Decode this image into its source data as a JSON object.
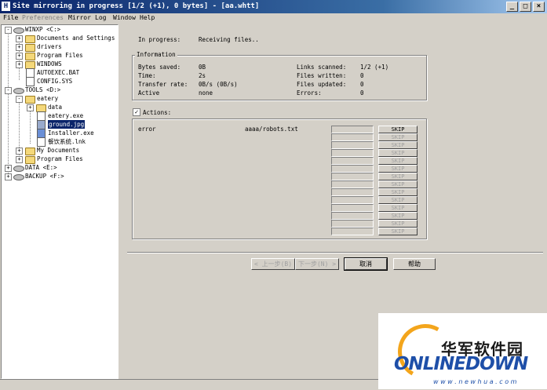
{
  "window": {
    "title": "Site mirroring in progress [1/2 (+1), 0 bytes] - [aa.whtt]",
    "app_icon": "H",
    "min": "_",
    "max": "□",
    "close": "×"
  },
  "menu": {
    "file": "File",
    "preferences": "Preferences",
    "mirror": "Mirror",
    "log": "Log",
    "window": "Window",
    "help": "Help"
  },
  "tree": {
    "winxp": "WINXP <C:>",
    "documents": "Documents and Settings",
    "drivers": "drivers",
    "program_files": "Program Files",
    "windows": "WINDOWS",
    "autoexec": "AUTOEXEC.BAT",
    "config": "CONFIG.SYS",
    "tools": "TOOLS <D:>",
    "eatery": "eatery",
    "data": "data",
    "eatery_exe": "eatery.exe",
    "ground": "ground.jpg",
    "installer": "Installer.exe",
    "lnk": "餐饮系统.lnk",
    "my_documents": "My Documents",
    "program_files2": "Program Files",
    "data_drive": "DATA <E:>",
    "backup_drive": "BACKUP <F:>"
  },
  "progress": {
    "label": "In progress:",
    "value": "Receiving files.."
  },
  "info": {
    "title": "Information",
    "bytes_saved_label": "Bytes saved:",
    "bytes_saved": "0B",
    "time_label": "Time:",
    "time": "2s",
    "rate_label": "Transfer rate:",
    "rate": "0B/s (0B/s)",
    "active_label": "Active",
    "active": "none",
    "links_label": "Links scanned:",
    "links": "1/2 (+1)",
    "written_label": "Files written:",
    "written": "0",
    "updated_label": "Files updated:",
    "updated": "0",
    "errors_label": "Errors:",
    "errors": "0"
  },
  "actions": {
    "title": "Actions:",
    "row1_status": "error",
    "row1_file": "aaaa/robots.txt",
    "skip": "SKIP"
  },
  "buttons": {
    "back": "< 上一步(B)",
    "next": "下一步(N) >",
    "cancel": "取消",
    "help": "帮助"
  },
  "watermark": {
    "cn": "华军软件园",
    "logo": "ONLINEDOWN",
    "url": "w w w . n e w h u a . c o m"
  }
}
